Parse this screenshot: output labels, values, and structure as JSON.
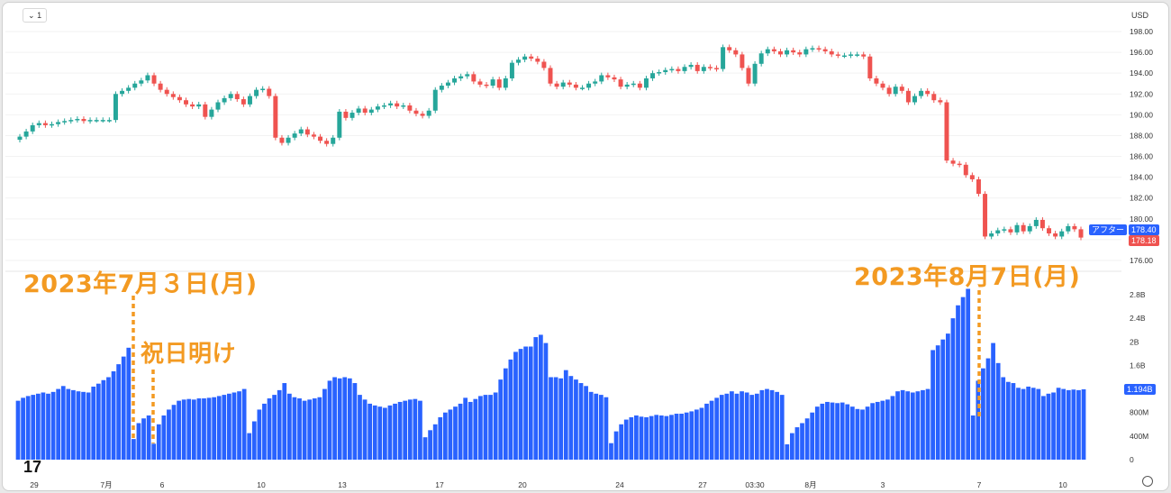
{
  "toolbar": {
    "interval_label": "1",
    "currency": "USD"
  },
  "annotations": {
    "left_date": "2023年7月３日(月)",
    "holiday": "祝日明け",
    "right_date": "2023年8月7日(月)"
  },
  "price_badges": {
    "after_label": "アフター",
    "after_price": "178.40",
    "last_price": "178.18"
  },
  "volume_badge": "1.194B",
  "colors": {
    "up": "#26a69a",
    "down": "#ef5350",
    "volume": "#2962ff",
    "annotation": "#f39a22"
  },
  "chart_data": [
    {
      "type": "candlestick",
      "ylim": [
        175,
        199
      ],
      "yticks": [
        "198.00",
        "196.00",
        "194.00",
        "192.00",
        "190.00",
        "188.00",
        "186.00",
        "184.00",
        "182.00",
        "180.00",
        "178.00",
        "176.00"
      ],
      "closes": [
        187.9,
        188.4,
        189.0,
        189.2,
        189.0,
        189.1,
        189.3,
        189.4,
        189.5,
        189.6,
        189.4,
        189.5,
        189.5,
        189.5,
        189.5,
        192.0,
        192.3,
        192.6,
        193.0,
        193.3,
        193.8,
        193.0,
        192.4,
        192.0,
        191.7,
        191.4,
        191.0,
        190.8,
        191.0,
        189.8,
        190.5,
        191.2,
        191.6,
        192.0,
        191.5,
        191.0,
        191.8,
        192.4,
        192.5,
        191.8,
        187.8,
        187.3,
        187.8,
        188.2,
        188.6,
        188.1,
        187.9,
        187.5,
        187.2,
        187.8,
        190.3,
        189.7,
        190.2,
        190.6,
        190.2,
        190.5,
        190.8,
        190.9,
        191.1,
        190.8,
        190.9,
        190.4,
        190.1,
        189.9,
        190.4,
        192.4,
        192.8,
        193.1,
        193.5,
        193.7,
        193.9,
        193.2,
        192.9,
        192.8,
        193.4,
        192.6,
        193.5,
        195.0,
        195.3,
        195.6,
        195.4,
        195.1,
        194.5,
        193.0,
        192.7,
        193.1,
        192.9,
        192.6,
        192.6,
        193.0,
        193.2,
        193.8,
        193.6,
        193.4,
        192.7,
        192.9,
        193.0,
        192.6,
        193.5,
        194.0,
        194.1,
        194.3,
        194.4,
        194.2,
        194.6,
        194.8,
        194.2,
        194.6,
        194.5,
        194.4,
        196.5,
        196.2,
        195.8,
        194.5,
        193.0,
        194.9,
        195.9,
        196.3,
        196.1,
        195.8,
        196.2,
        196.0,
        195.8,
        196.3,
        196.4,
        196.3,
        196.1,
        195.8,
        195.7,
        195.7,
        195.8,
        195.8,
        195.6,
        193.5,
        193.0,
        192.6,
        192.0,
        192.7,
        192.3,
        191.2,
        191.8,
        192.3,
        192.0,
        191.4,
        191.2,
        185.6,
        185.3,
        185.2,
        184.2,
        183.8,
        182.4,
        178.3,
        178.6,
        178.9,
        179.0,
        178.7,
        179.4,
        178.8,
        179.3,
        179.9,
        179.1,
        178.6,
        178.3,
        178.8,
        179.3,
        179.0,
        178.2
      ],
      "x_labels": [
        "29",
        "7月",
        "6",
        "10",
        "13",
        "17",
        "20",
        "24",
        "27",
        "03:30",
        "8月",
        "3",
        "7",
        "10"
      ]
    },
    {
      "type": "bar",
      "ylim": [
        0,
        2.9
      ],
      "yticks": [
        "2.8B",
        "2.4B",
        "2B",
        "1.6B",
        "1.2B",
        "800M",
        "400M",
        "0"
      ],
      "values": [
        1.0,
        1.05,
        1.08,
        1.1,
        1.12,
        1.14,
        1.12,
        1.15,
        1.2,
        1.25,
        1.2,
        1.18,
        1.16,
        1.15,
        1.14,
        1.24,
        1.29,
        1.35,
        1.4,
        1.5,
        1.62,
        1.75,
        1.9,
        0.35,
        0.62,
        0.7,
        0.75,
        0.27,
        0.6,
        0.75,
        0.85,
        0.93,
        1.0,
        1.02,
        1.03,
        1.02,
        1.04,
        1.04,
        1.05,
        1.06,
        1.08,
        1.1,
        1.12,
        1.14,
        1.16,
        1.2,
        0.45,
        0.65,
        0.85,
        0.95,
        1.04,
        1.1,
        1.18,
        1.3,
        1.12,
        1.06,
        1.04,
        1.0,
        1.02,
        1.04,
        1.06,
        1.2,
        1.34,
        1.4,
        1.38,
        1.4,
        1.38,
        1.3,
        1.1,
        1.02,
        0.95,
        0.92,
        0.9,
        0.88,
        0.92,
        0.95,
        0.98,
        1.0,
        1.02,
        1.03,
        1.0,
        0.38,
        0.5,
        0.6,
        0.72,
        0.8,
        0.85,
        0.9,
        0.95,
        1.05,
        0.98,
        1.03,
        1.08,
        1.1,
        1.1,
        1.14,
        1.36,
        1.55,
        1.7,
        1.83,
        1.88,
        1.92,
        1.92,
        2.08,
        2.12,
        1.98,
        1.4,
        1.4,
        1.38,
        1.52,
        1.42,
        1.36,
        1.3,
        1.25,
        1.15,
        1.12,
        1.1,
        1.06,
        0.28,
        0.48,
        0.6,
        0.68,
        0.72,
        0.75,
        0.73,
        0.72,
        0.74,
        0.76,
        0.75,
        0.74,
        0.76,
        0.78,
        0.78,
        0.8,
        0.82,
        0.85,
        0.88,
        0.95,
        1.0,
        1.05,
        1.1,
        1.12,
        1.16,
        1.12,
        1.16,
        1.14,
        1.1,
        1.12,
        1.18,
        1.2,
        1.18,
        1.15,
        1.1,
        0.26,
        0.45,
        0.55,
        0.62,
        0.7,
        0.8,
        0.9,
        0.95,
        0.98,
        0.97,
        0.96,
        0.97,
        0.94,
        0.9,
        0.86,
        0.85,
        0.9,
        0.96,
        0.98,
        1.0,
        1.02,
        1.08,
        1.16,
        1.18,
        1.16,
        1.14,
        1.16,
        1.18,
        1.2,
        1.86,
        1.94,
        2.04,
        2.14,
        2.4,
        2.62,
        2.76,
        2.9,
        0.75,
        1.34,
        1.55,
        1.72,
        1.98,
        1.64,
        1.4,
        1.32,
        1.3,
        1.22,
        1.2,
        1.24,
        1.22,
        1.2,
        1.08,
        1.12,
        1.14,
        1.22,
        1.2,
        1.18,
        1.19,
        1.18,
        1.194
      ]
    }
  ]
}
